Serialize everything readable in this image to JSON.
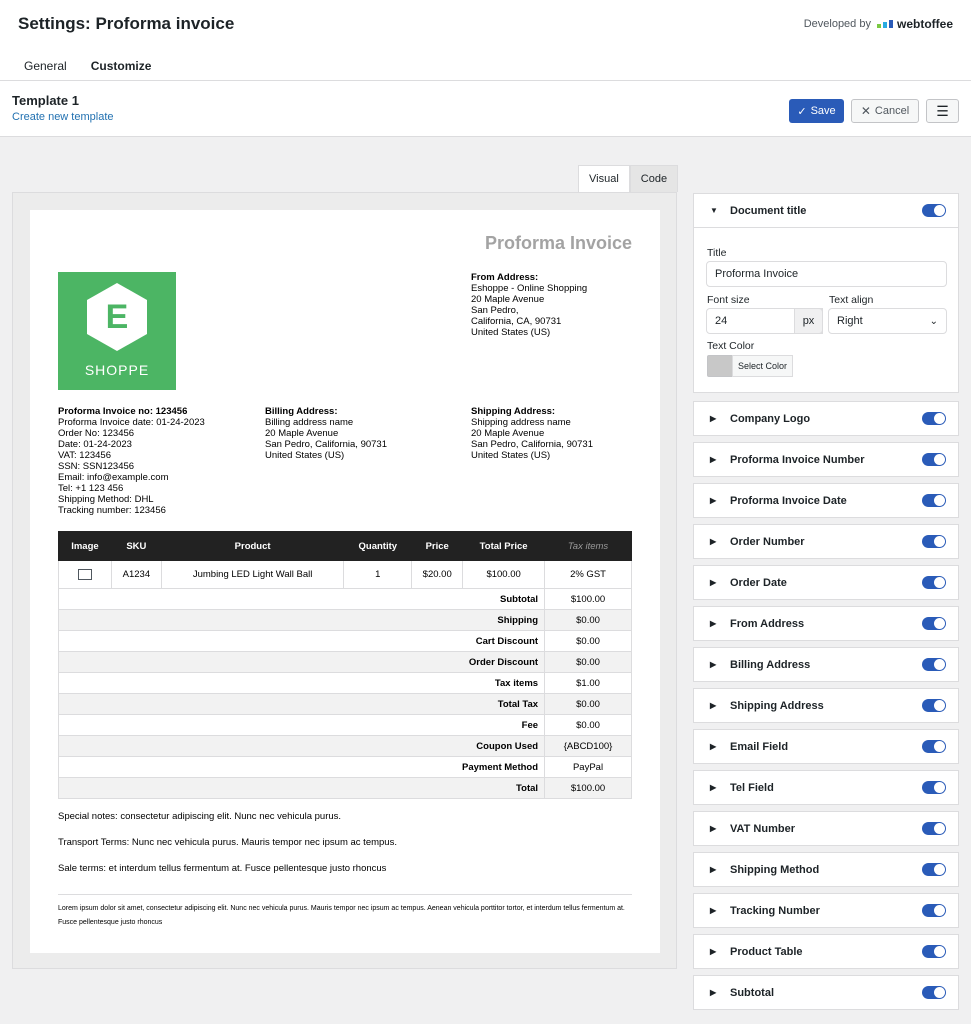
{
  "header": {
    "title": "Settings: Proforma invoice",
    "developed_by": "Developed by",
    "brand": "webtoffee"
  },
  "tabs": [
    {
      "label": "General"
    },
    {
      "label": "Customize"
    }
  ],
  "template": {
    "name": "Template 1",
    "create_link": "Create new template"
  },
  "actions": {
    "save": "Save",
    "cancel": "Cancel"
  },
  "editor_tabs": [
    {
      "label": "Visual"
    },
    {
      "label": "Code"
    }
  ],
  "invoice": {
    "title": "Proforma Invoice",
    "logo_letter": "E",
    "logo_text": "SHOPPE",
    "from": {
      "heading": "From Address:",
      "lines": [
        "Eshoppe - Online Shopping",
        "20 Maple Avenue",
        "San Pedro,",
        "California, CA, 90731",
        "United States (US)"
      ]
    },
    "details": {
      "heading": "Proforma Invoice no: 123456",
      "lines": [
        "Proforma Invoice date: 01-24-2023",
        "Order No: 123456",
        "Date: 01-24-2023",
        "VAT: 123456",
        "SSN: SSN123456",
        "Email: info@example.com",
        "Tel: +1 123 456",
        "Shipping Method: DHL",
        "Tracking number: 123456"
      ]
    },
    "billing": {
      "heading": "Billing Address:",
      "lines": [
        "Billing address name",
        "20 Maple Avenue",
        "San Pedro, California, 90731",
        "United States (US)"
      ]
    },
    "shipping": {
      "heading": "Shipping Address:",
      "lines": [
        "Shipping address name",
        "20 Maple Avenue",
        "San Pedro, California, 90731",
        "United States (US)"
      ]
    },
    "table_headers": [
      "Image",
      "SKU",
      "Product",
      "Quantity",
      "Price",
      "Total Price",
      "Tax items"
    ],
    "product": {
      "sku": "A1234",
      "name": "Jumbing LED Light Wall Ball",
      "qty": "1",
      "price": "$20.00",
      "total": "$100.00",
      "tax": "2% GST"
    },
    "totals": [
      {
        "label": "Subtotal",
        "value": "$100.00"
      },
      {
        "label": "Shipping",
        "value": "$0.00"
      },
      {
        "label": "Cart Discount",
        "value": "$0.00"
      },
      {
        "label": "Order Discount",
        "value": "$0.00"
      },
      {
        "label": "Tax items",
        "value": "$1.00"
      },
      {
        "label": "Total Tax",
        "value": "$0.00"
      },
      {
        "label": "Fee",
        "value": "$0.00"
      },
      {
        "label": "Coupon Used",
        "value": "{ABCD100}"
      },
      {
        "label": "Payment Method",
        "value": "PayPal"
      },
      {
        "label": "Total",
        "value": "$100.00"
      }
    ],
    "notes": [
      "Special notes: consectetur adipiscing elit. Nunc nec vehicula purus.",
      "Transport Terms: Nunc nec vehicula purus. Mauris tempor nec ipsum ac tempus.",
      "Sale terms: et interdum tellus fermentum at. Fusce pellentesque justo rhoncus"
    ],
    "footer": "Lorem ipsum dolor sit amet, consectetur adipiscing elit. Nunc nec vehicula purus. Mauris tempor nec ipsum ac tempus. Aenean vehicula porttitor tortor, et interdum tellus fermentum at. Fusce pellentesque justo rhoncus"
  },
  "doc_title_panel": {
    "heading": "Document title",
    "title_label": "Title",
    "title_value": "Proforma Invoice",
    "font_size_label": "Font size",
    "font_size_value": "24",
    "font_unit": "px",
    "align_label": "Text align",
    "align_value": "Right",
    "color_label": "Text Color",
    "color_button": "Select Color"
  },
  "sections": [
    "Company Logo",
    "Proforma Invoice Number",
    "Proforma Invoice Date",
    "Order Number",
    "Order Date",
    "From Address",
    "Billing Address",
    "Shipping Address",
    "Email Field",
    "Tel Field",
    "VAT Number",
    "Shipping Method",
    "Tracking Number",
    "Product Table",
    "Subtotal"
  ]
}
